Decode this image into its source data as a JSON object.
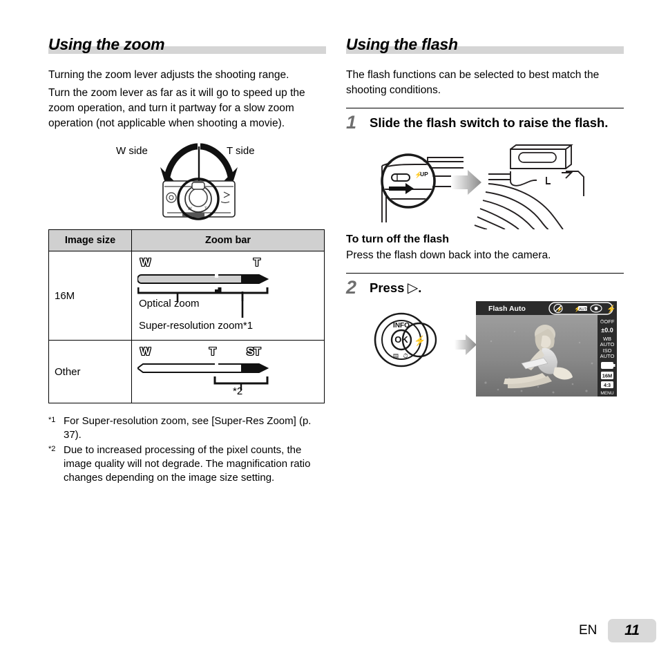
{
  "page": {
    "language_code": "EN",
    "page_number": "11"
  },
  "left_column": {
    "heading": "Using the zoom",
    "paragraphs": [
      "Turning the zoom lever adjusts the shooting range.",
      "Turn the zoom lever as far as it will go to speed up the zoom operation, and turn it partway for a slow zoom operation (not applicable when shooting a movie)."
    ],
    "lever_figure": {
      "label_left": "W side",
      "label_right": "T side",
      "art_name": "camera-zoom-lever-top-view"
    },
    "table": {
      "headers": [
        "Image size",
        "Zoom bar"
      ],
      "rows": [
        {
          "size": "16M",
          "bar_labels": [
            "W",
            "T"
          ],
          "annotations": [
            "Optical zoom",
            "Super-resolution zoom*1"
          ]
        },
        {
          "size": "Other",
          "bar_labels": [
            "W",
            "T",
            "ST"
          ],
          "annotations": [
            "*2"
          ]
        }
      ]
    },
    "footnotes": [
      {
        "marker": "*1",
        "text": "For Super-resolution zoom, see [Super-Res Zoom] (p. 37)."
      },
      {
        "marker": "*2",
        "text": "Due to increased processing of the pixel counts, the image quality will not degrade. The magnification ratio changes depending on the image size setting."
      }
    ]
  },
  "right_column": {
    "heading": "Using the flash",
    "intro": "The flash functions can be selected to best match the shooting conditions.",
    "step1": {
      "number": "1",
      "text": "Slide the flash switch to raise the flash.",
      "figure": {
        "switch_label": "UP",
        "art_left_name": "camera-flash-switch-closeup",
        "art_right_name": "camera-flash-raised"
      }
    },
    "turn_off": {
      "heading": "To turn off the flash",
      "text": "Press the flash down back into the camera."
    },
    "step2": {
      "number": "2",
      "text": "Press",
      "text_suffix": ".",
      "button_glyph": "▷",
      "dial": {
        "top_label": "INFO",
        "center_label": "OK",
        "right_glyph": "⚡"
      },
      "lcd": {
        "mode_label": "Flash Auto",
        "flash_options": [
          "flash-off-icon",
          "flash-auto-icon",
          "red-eye-icon",
          "fill-in-icon"
        ],
        "sidebar": [
          "self-timer-off",
          "±0.0",
          "WB",
          "AUTO",
          "ISO",
          "AUTO",
          "battery-icon",
          "16M",
          "4:3"
        ],
        "menu_label": "MENU",
        "photo_name": "woman-reading-on-grass-photo"
      }
    }
  },
  "colors": {
    "heading_bar": "#d5d5d5",
    "table_header": "#d0d0d0",
    "step_number": "#6f6f6f",
    "page_badge": "#d9d9d9"
  }
}
